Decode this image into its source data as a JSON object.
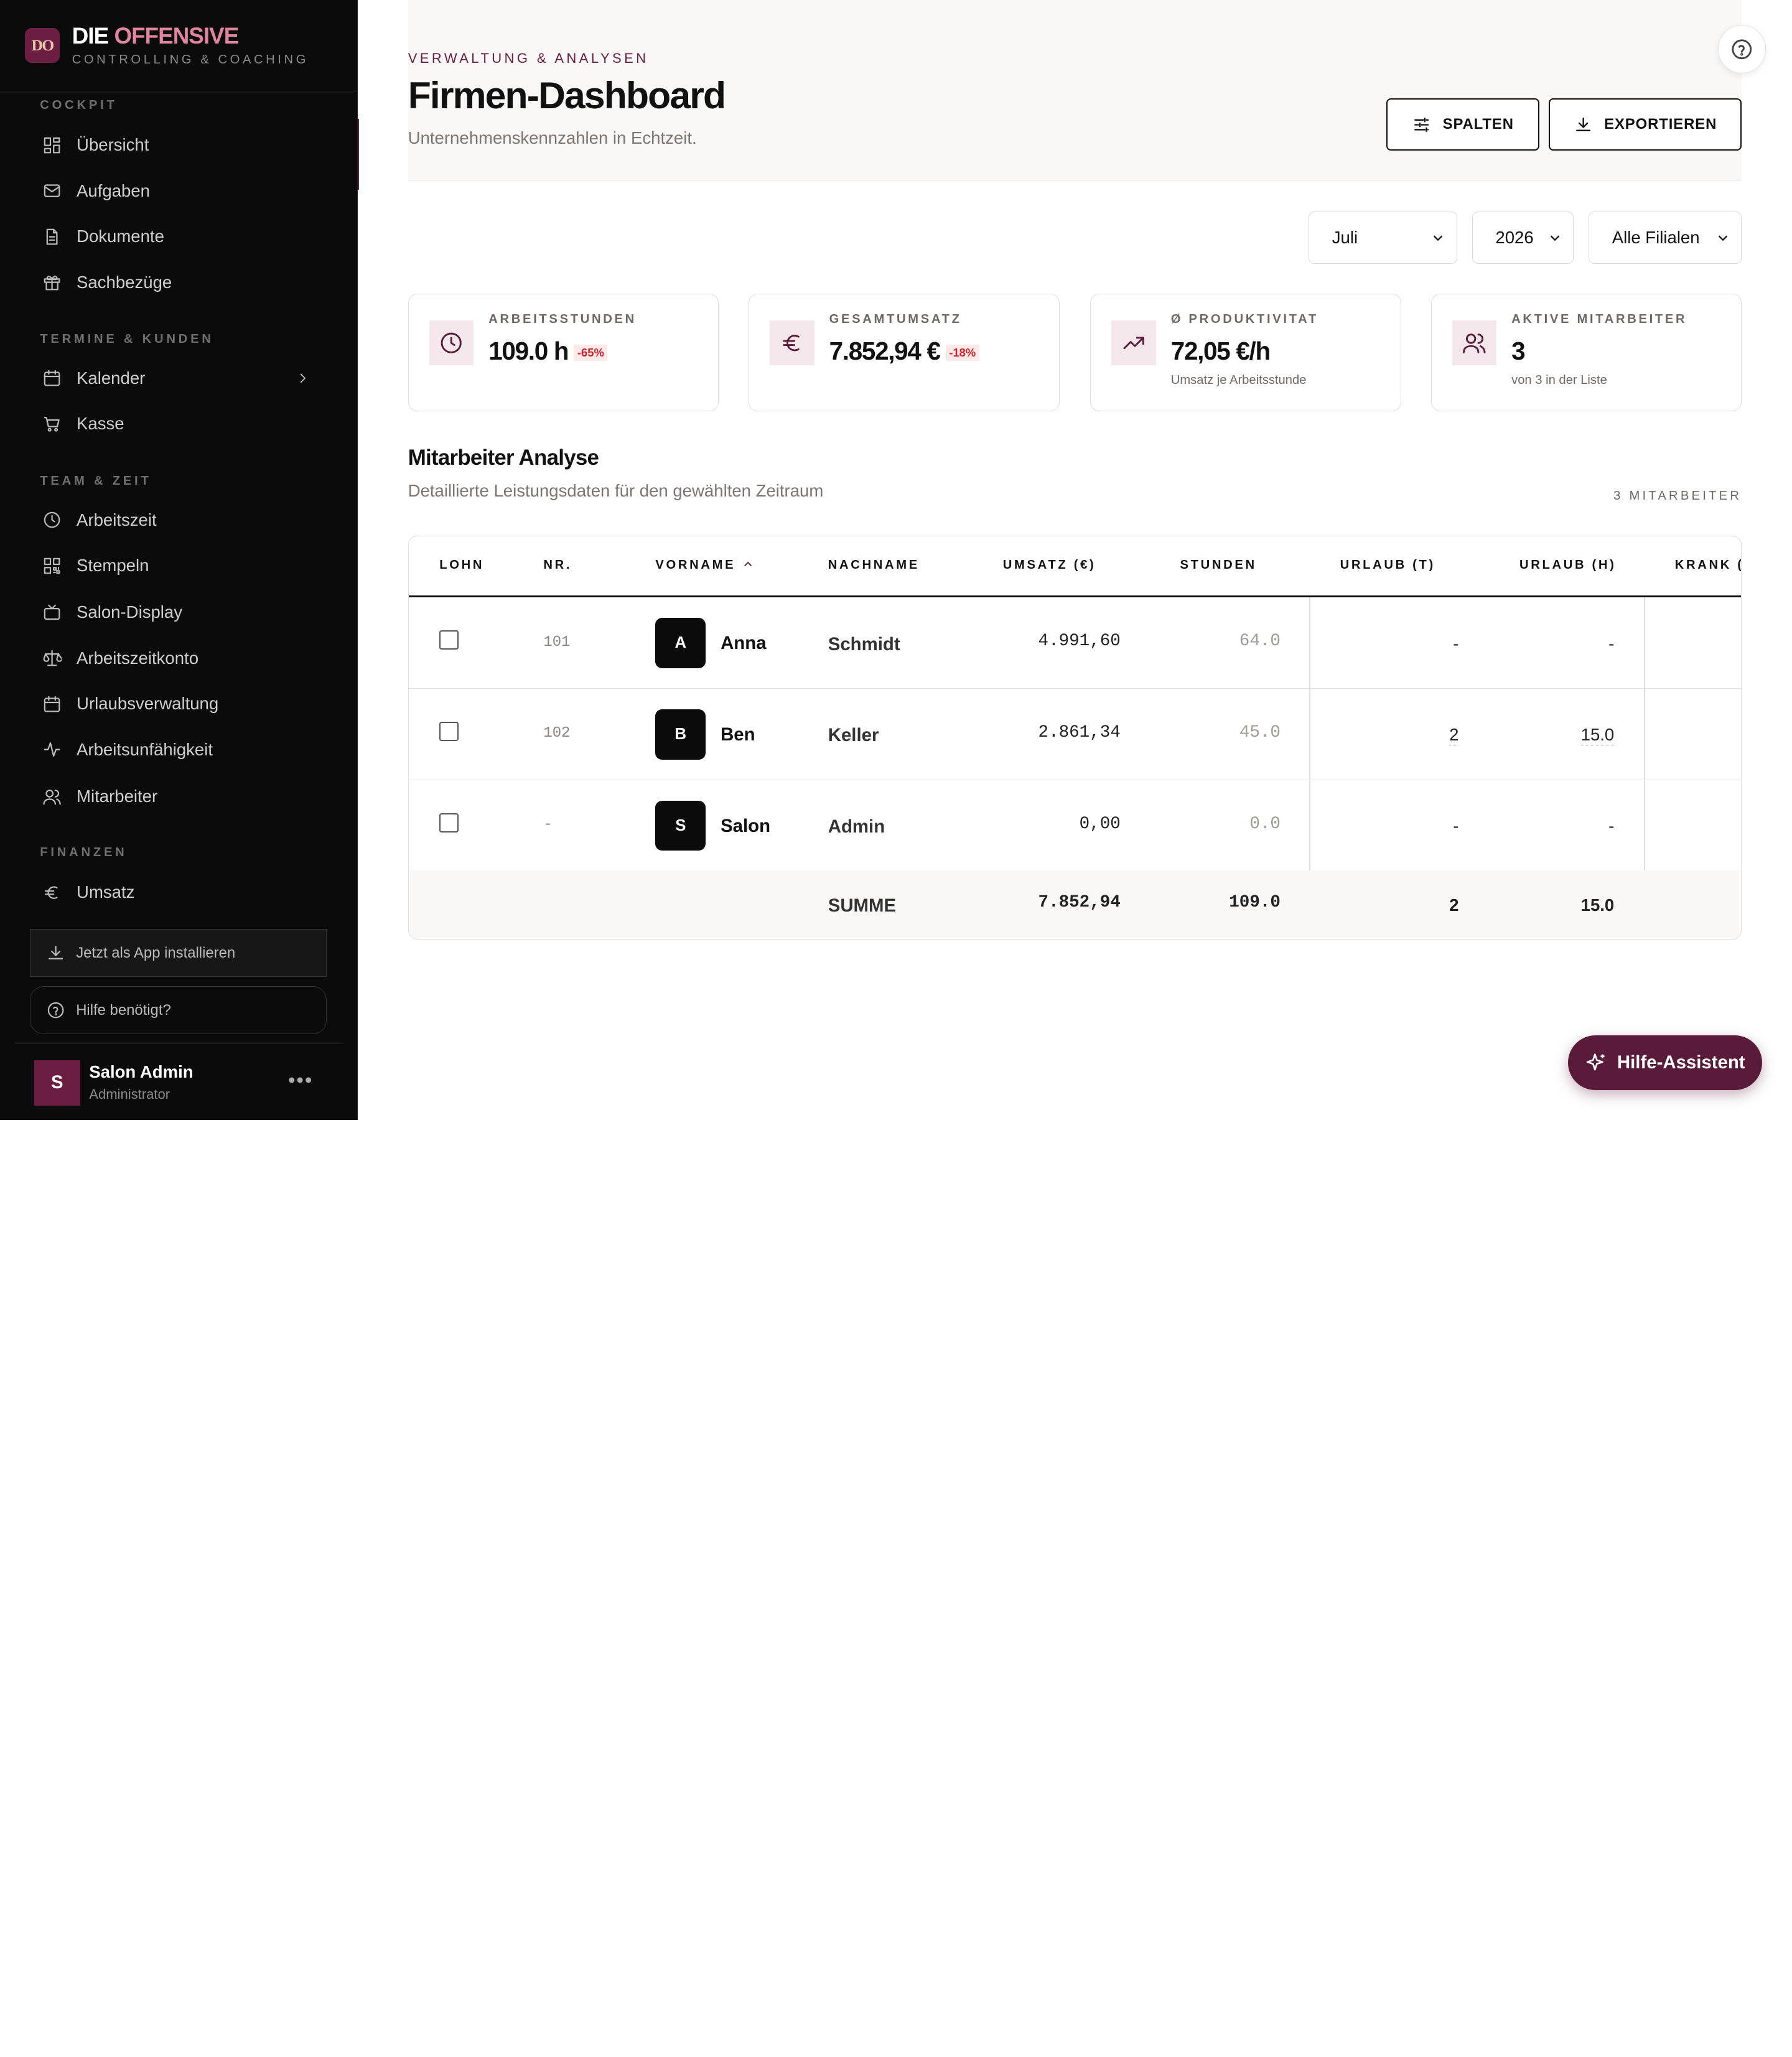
{
  "brand": {
    "logo_text": "DO",
    "title_main": "DIE",
    "title_accent": "OFFENSIVE",
    "subtitle": "CONTROLLING & COACHING",
    "accent_color": "#6b1d42"
  },
  "sidebar": {
    "sections": [
      {
        "title": "COCKPIT",
        "items": [
          {
            "label": "Übersicht",
            "icon": "grid-icon"
          },
          {
            "label": "Aufgaben",
            "icon": "mail-icon"
          },
          {
            "label": "Dokumente",
            "icon": "document-icon"
          },
          {
            "label": "Sachbezüge",
            "icon": "gift-icon"
          }
        ]
      },
      {
        "title": "TERMINE & KUNDEN",
        "items": [
          {
            "label": "Kalender",
            "icon": "calendar-icon"
          },
          {
            "label": "Kasse",
            "icon": "cart-icon"
          }
        ]
      },
      {
        "title": "TEAM & ZEIT",
        "items": [
          {
            "label": "Arbeitszeit",
            "icon": "clock-icon"
          },
          {
            "label": "Stempeln",
            "icon": "qr-icon"
          },
          {
            "label": "Salon-Display",
            "icon": "tv-icon"
          },
          {
            "label": "Arbeitszeitkonto",
            "icon": "scale-icon"
          },
          {
            "label": "Urlaubsverwaltung",
            "icon": "calendar-icon"
          },
          {
            "label": "Arbeitsunfähigkeit",
            "icon": "activity-icon"
          },
          {
            "label": "Mitarbeiter",
            "icon": "users-icon"
          }
        ]
      },
      {
        "title": "FINANZEN",
        "items": [
          {
            "label": "Umsatz",
            "icon": "euro-icon"
          }
        ]
      }
    ],
    "install_label": "Jetzt als App installieren",
    "help_label": "Hilfe benötigt?",
    "user": {
      "initial": "S",
      "name": "Salon Admin",
      "role": "Administrator"
    }
  },
  "header": {
    "eyebrow": "VERWALTUNG & ANALYSEN",
    "title": "Firmen-Dashboard",
    "subtitle": "Unternehmenskennzahlen in Echtzeit.",
    "columns_button": "SPALTEN",
    "export_button": "EXPORTIEREN"
  },
  "filters": {
    "month": "Juli",
    "year": "2026",
    "branch": "Alle Filialen"
  },
  "kpis": [
    {
      "label": "ARBEITSSTUNDEN",
      "value": "109.0 h",
      "badge": "-65%",
      "note": "",
      "icon": "clock-icon"
    },
    {
      "label": "GESAMTUMSATZ",
      "value": "7.852,94 €",
      "badge": "-18%",
      "note": "",
      "icon": "euro-icon"
    },
    {
      "label": "Ø PRODUKTIVITAT",
      "value": "72,05 €/h",
      "badge": "",
      "note": "Umsatz je Arbeitsstunde",
      "icon": "trending-up-icon"
    },
    {
      "label": "AKTIVE MITARBEITER",
      "value": "3",
      "badge": "",
      "note": "von 3 in der Liste",
      "icon": "users-icon"
    }
  ],
  "analysis": {
    "title": "Mitarbeiter Analyse",
    "subtitle": "Detaillierte Leistungsdaten für den gewählten Zeitraum",
    "count": "3 MITARBEITER"
  },
  "table": {
    "columns": [
      "LOHN",
      "NR.",
      "VORNAME",
      "NACHNAME",
      "UMSATZ (€)",
      "STUNDEN",
      "URLAUB (T)",
      "URLAUB (H)",
      "KRANK ("
    ],
    "rows": [
      {
        "nr": "101",
        "initial": "A",
        "vorname": "Anna",
        "nachname": "Schmidt",
        "umsatz": "4.991,60",
        "stunden": "64.0",
        "urlaub_t": "-",
        "urlaub_h": "-"
      },
      {
        "nr": "102",
        "initial": "B",
        "vorname": "Ben",
        "nachname": "Keller",
        "umsatz": "2.861,34",
        "stunden": "45.0",
        "urlaub_t": "2",
        "urlaub_h": "15.0"
      },
      {
        "nr": "-",
        "initial": "S",
        "vorname": "Salon",
        "nachname": "Admin",
        "umsatz": "0,00",
        "stunden": "0.0",
        "urlaub_t": "-",
        "urlaub_h": "-"
      }
    ],
    "summary": {
      "label": "SUMME",
      "umsatz": "7.852,94",
      "stunden": "109.0",
      "urlaub_t": "2",
      "urlaub_h": "15.0"
    }
  },
  "assistant_label": "Hilfe-Assistent"
}
